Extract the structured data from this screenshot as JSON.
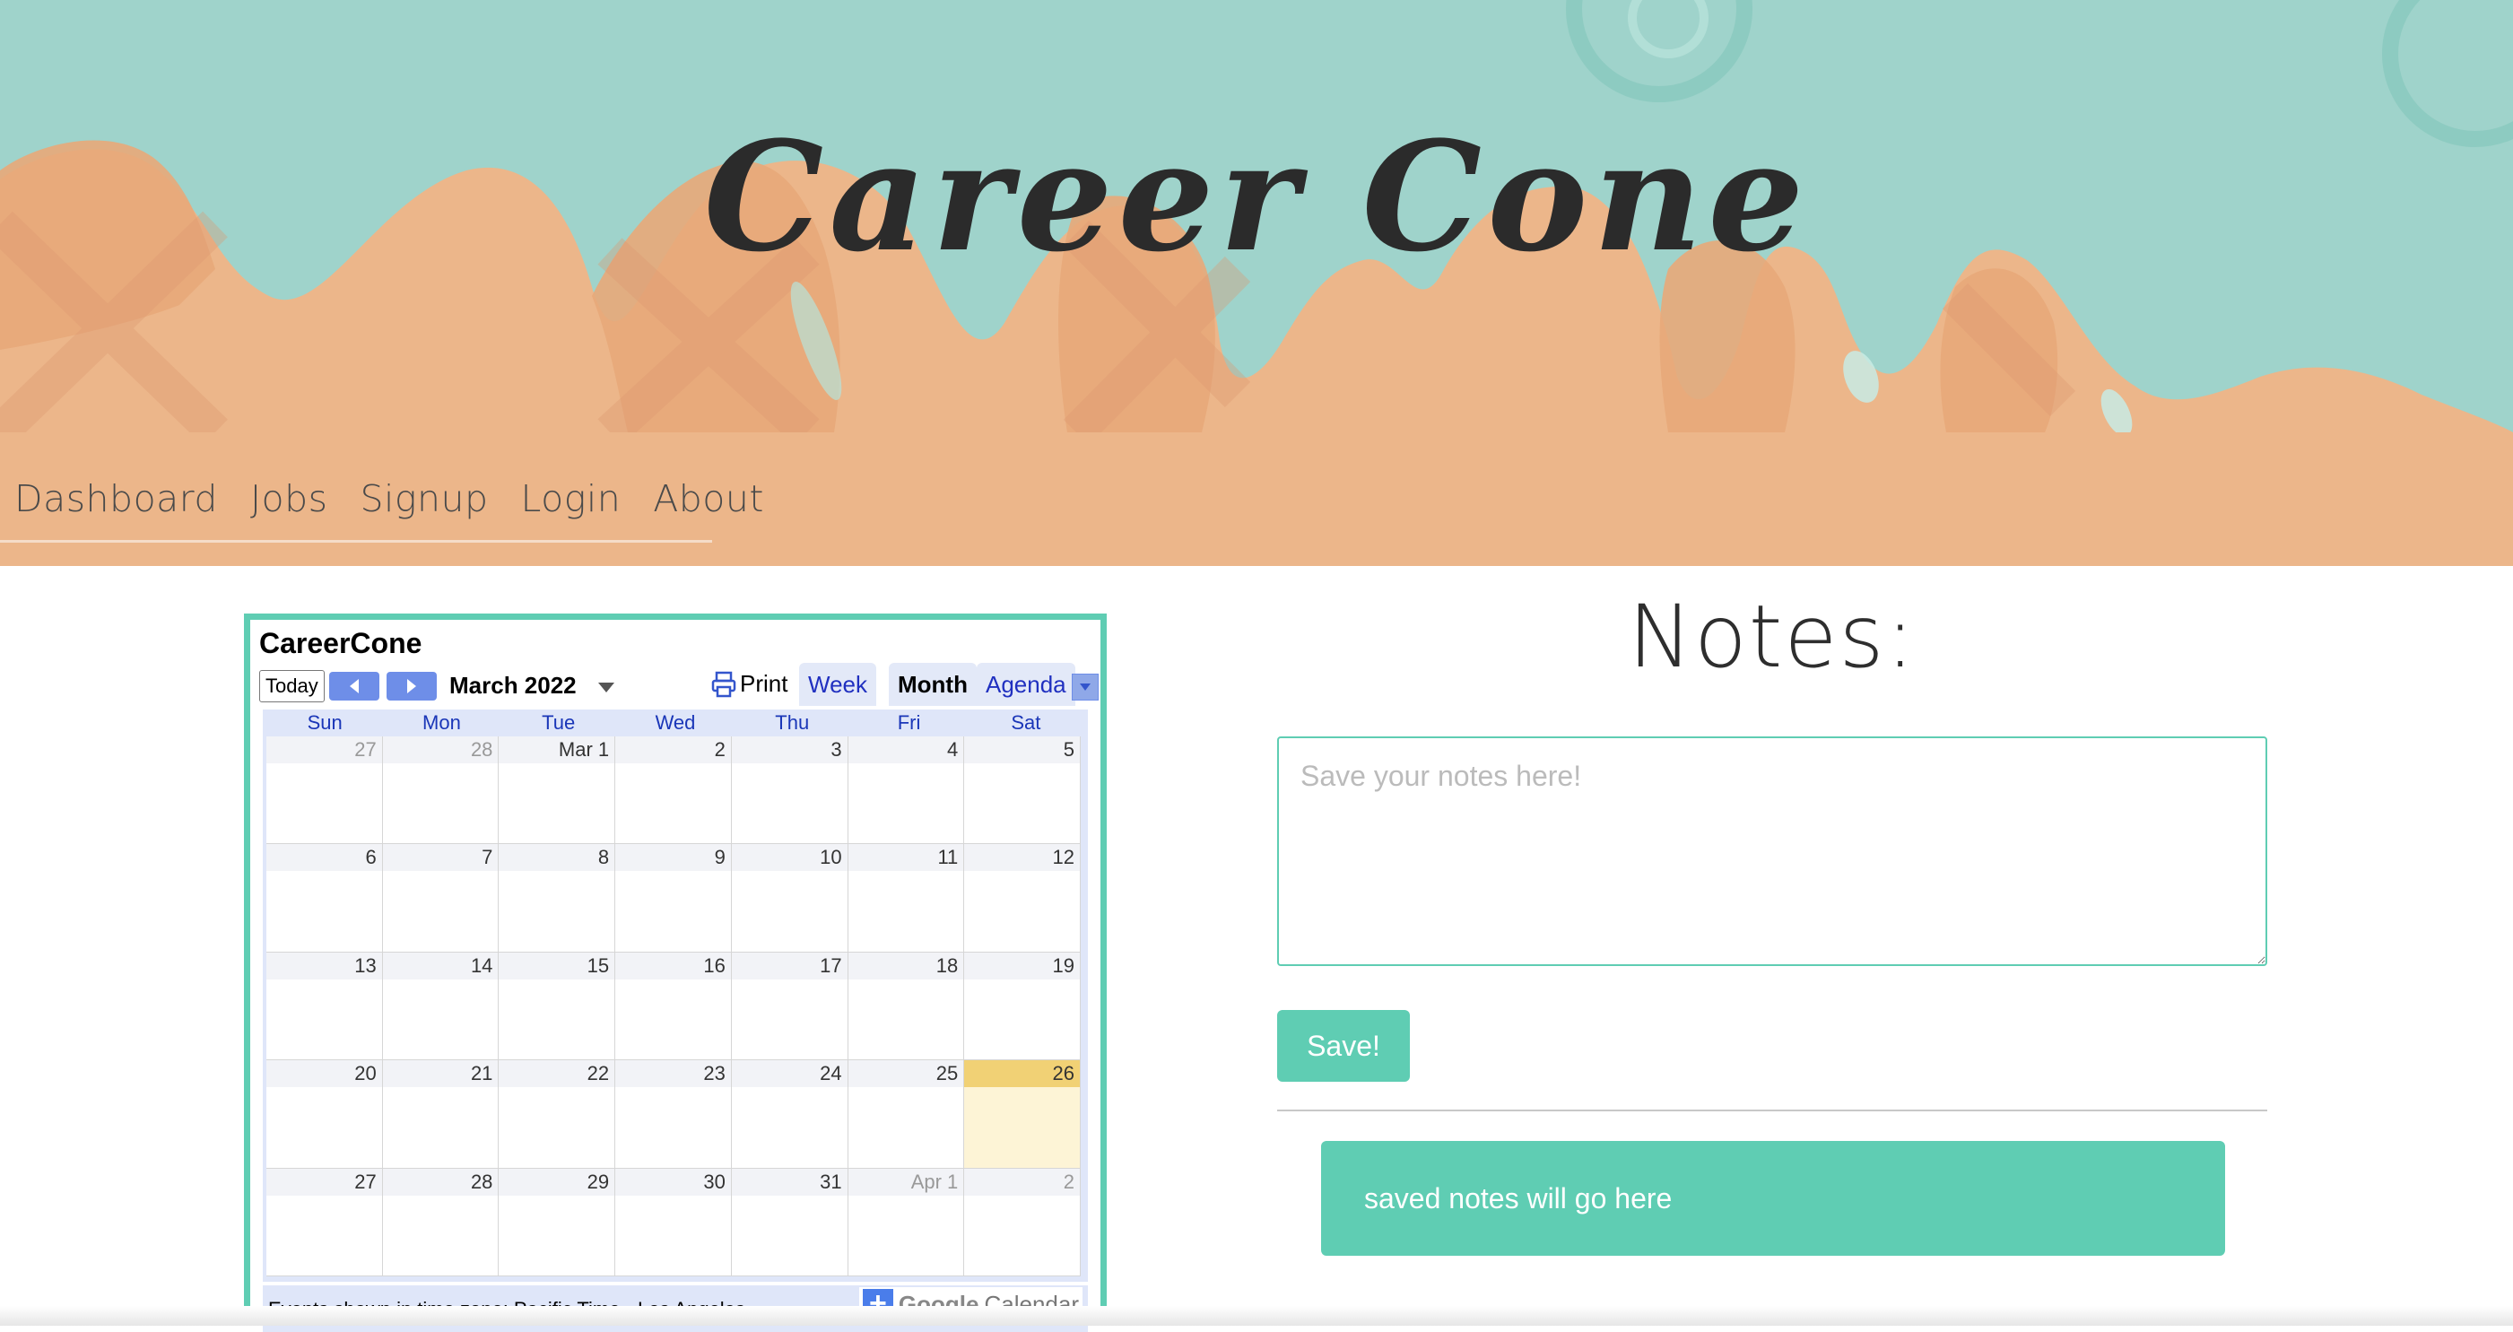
{
  "site": {
    "title": "Career Cone"
  },
  "nav": {
    "items": [
      {
        "label": "Dashboard"
      },
      {
        "label": "Jobs"
      },
      {
        "label": "Signup"
      },
      {
        "label": "Login"
      },
      {
        "label": "About"
      }
    ]
  },
  "calendar": {
    "title": "CareerCone",
    "today_label": "Today",
    "month_label": "March 2022",
    "print_label": "Print",
    "views": {
      "week": "Week",
      "month": "Month",
      "agenda": "Agenda"
    },
    "active_view": "Month",
    "weekdays": [
      "Sun",
      "Mon",
      "Tue",
      "Wed",
      "Thu",
      "Fri",
      "Sat"
    ],
    "weeks": [
      [
        "27",
        "28",
        "Mar 1",
        "2",
        "3",
        "4",
        "5"
      ],
      [
        "6",
        "7",
        "8",
        "9",
        "10",
        "11",
        "12"
      ],
      [
        "13",
        "14",
        "15",
        "16",
        "17",
        "18",
        "19"
      ],
      [
        "20",
        "21",
        "22",
        "23",
        "24",
        "25",
        "26"
      ],
      [
        "27",
        "28",
        "29",
        "30",
        "31",
        "Apr 1",
        "2"
      ]
    ],
    "today": "26",
    "timezone_note": "Events shown in time zone: Pacific Time - Los Angeles",
    "badge": {
      "plus": "+",
      "google": "Google",
      "calendar": "Calendar"
    },
    "colors": {
      "accent": "#6e8ee8",
      "today": "#f1d175",
      "frame": "#5fcdb3"
    }
  },
  "notes": {
    "heading": "Notes:",
    "placeholder": "Save your notes here!",
    "value": "",
    "save_label": "Save!",
    "saved_placeholder": "saved notes will go here"
  },
  "colors": {
    "sky": "#9fd3cb",
    "cone": "#ecb68a",
    "accent": "#5fcdb3"
  }
}
